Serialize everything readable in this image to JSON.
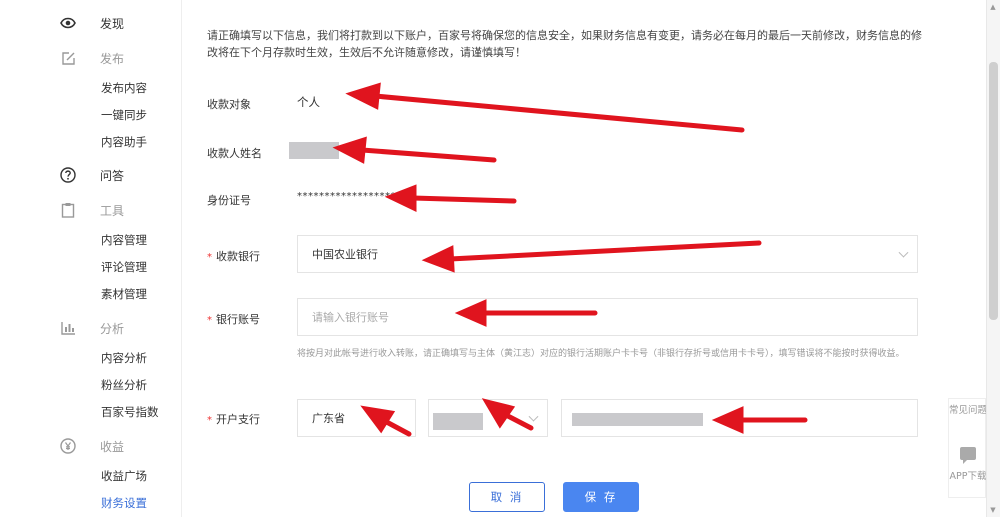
{
  "sidebar": {
    "sections": [
      {
        "label": "发现",
        "icon": "eye-icon"
      },
      {
        "label": "发布",
        "icon": "edit-icon",
        "items": [
          "发布内容",
          "一键同步",
          "内容助手"
        ]
      },
      {
        "label": "问答",
        "icon": "question-icon"
      },
      {
        "label": "工具",
        "icon": "clipboard-icon",
        "items": [
          "内容管理",
          "评论管理",
          "素材管理"
        ]
      },
      {
        "label": "分析",
        "icon": "bar-chart-icon",
        "items": [
          "内容分析",
          "粉丝分析",
          "百家号指数"
        ]
      },
      {
        "label": "收益",
        "icon": "yen-icon",
        "items": [
          "收益广场",
          "财务设置"
        ]
      }
    ],
    "active_item": "财务设置"
  },
  "notice": "请正确填写以下信息，我们将打款到以下账户，百家号将确保您的信息安全，如果财务信息有变更，请务必在每月的最后一天前修改，财务信息的修改将在下个月存款时生效，生效后不允许随意修改，请谨慎填写！",
  "form": {
    "payee_type": {
      "label": "收款对象",
      "value": "个人"
    },
    "payee_name": {
      "label": "收款人姓名"
    },
    "id_number": {
      "label": "身份证号",
      "value": "******************"
    },
    "bank": {
      "label": "收款银行",
      "value": "中国农业银行"
    },
    "account": {
      "label": "银行账号",
      "placeholder": "请输入银行账号",
      "hint": "将按月对此帐号进行收入转账，请正确填写与主体（黄江志）对应的银行活期账户卡卡号（非银行存折号或信用卡卡号），填写错误将不能按时获得收益。"
    },
    "branch": {
      "label": "开户支行",
      "province": "广东省"
    },
    "required_mark": "*"
  },
  "buttons": {
    "cancel": "取 消",
    "save": "保 存"
  },
  "float": {
    "faq": "常见问题",
    "app": "APP下载"
  },
  "colors": {
    "accent": "#4a86f0",
    "annotation_arrow": "#e0141e",
    "required": "#e33333"
  }
}
